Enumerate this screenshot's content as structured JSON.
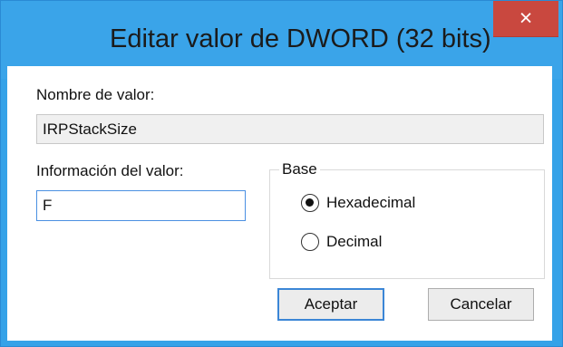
{
  "window": {
    "title": "Editar valor de DWORD (32 bits)",
    "close_glyph": "×",
    "accent_color": "#3aa4e9",
    "close_color": "#c9483f"
  },
  "value_name": {
    "label": "Nombre de valor:",
    "value": "IRPStackSize"
  },
  "value_data": {
    "label": "Información del valor:",
    "value": "F"
  },
  "base": {
    "title": "Base",
    "options": [
      {
        "label": "Hexadecimal",
        "selected": true
      },
      {
        "label": "Decimal",
        "selected": false
      }
    ]
  },
  "buttons": {
    "ok": "Aceptar",
    "cancel": "Cancelar"
  }
}
